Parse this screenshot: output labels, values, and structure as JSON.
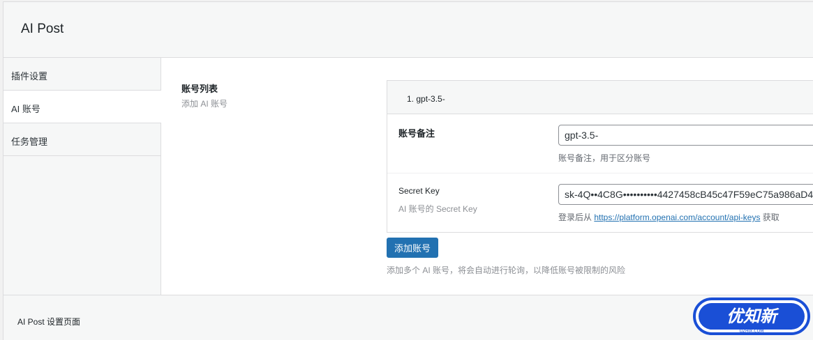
{
  "app": {
    "title": "AI Post"
  },
  "sidebar": {
    "items": [
      {
        "label": "插件设置",
        "active": false
      },
      {
        "label": "AI 账号",
        "active": true
      },
      {
        "label": "任务管理",
        "active": false
      }
    ]
  },
  "section": {
    "title": "账号列表",
    "description": "添加 AI 账号"
  },
  "account_card": {
    "header": "1. gpt-3.5-",
    "note": {
      "label": "账号备注",
      "value": "gpt-3.5-",
      "help": "账号备注，用于区分账号"
    },
    "secret": {
      "label": "Secret Key",
      "sublabel": "AI 账号的 Secret Key",
      "value": "sk-4Q••4C8G••••••••••4427458cB45c47F59eC75a986aD4",
      "help_prefix": "登录后从 ",
      "help_link": "https://platform.openai.com/account/api-keys",
      "help_suffix": " 获取"
    }
  },
  "add_button": {
    "label": "添加账号"
  },
  "add_description": "添加多个 AI 账号，将会自动进行轮询，以降低账号被限制的风险",
  "footer": {
    "text": "AI Post 设置页面"
  },
  "watermark": {
    "text": "优知新",
    "subtext": "UZHIX.COM"
  },
  "colors": {
    "accent": "#2271b1",
    "watermark": "#1a4fd6"
  }
}
